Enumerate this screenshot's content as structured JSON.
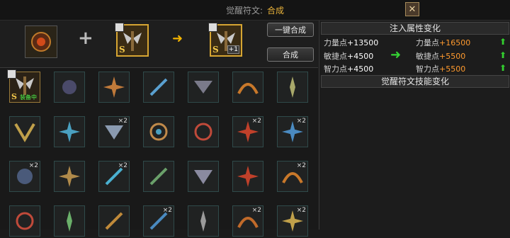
{
  "window": {
    "title_label": "觉醒符文:",
    "title_action": "合成",
    "close_icon": "close-x"
  },
  "top": {
    "plus_symbol": "+",
    "s_badge": "S",
    "plus_level": "+1",
    "btn_one_key": "一键合成",
    "btn_synth": "合成"
  },
  "inventory": {
    "equipped_label": "装备中",
    "equipped_s": "S",
    "counts": {
      "c1": "×2",
      "c2": "×2",
      "c3": "×2",
      "c4": "×2",
      "c5": "×2",
      "c6": "×2",
      "c7": "×2",
      "c8": "×2",
      "c9": "×2"
    }
  },
  "right": {
    "section_attr": "注入属性变化",
    "section_skill": "觉醒符文技能变化",
    "rows": [
      {
        "label": "力量点",
        "before": "+13500",
        "after_label": "力量点",
        "after": "+16500"
      },
      {
        "label": "敏捷点",
        "before": "+4500",
        "after_label": "敏捷点",
        "after": "+5500"
      },
      {
        "label": "智力点",
        "before": "+4500",
        "after_label": "智力点",
        "after": "+5500"
      }
    ]
  },
  "colors": {
    "accent": "#e9b23a",
    "increase": "#33d12f",
    "value_new": "#ff9a2e"
  }
}
